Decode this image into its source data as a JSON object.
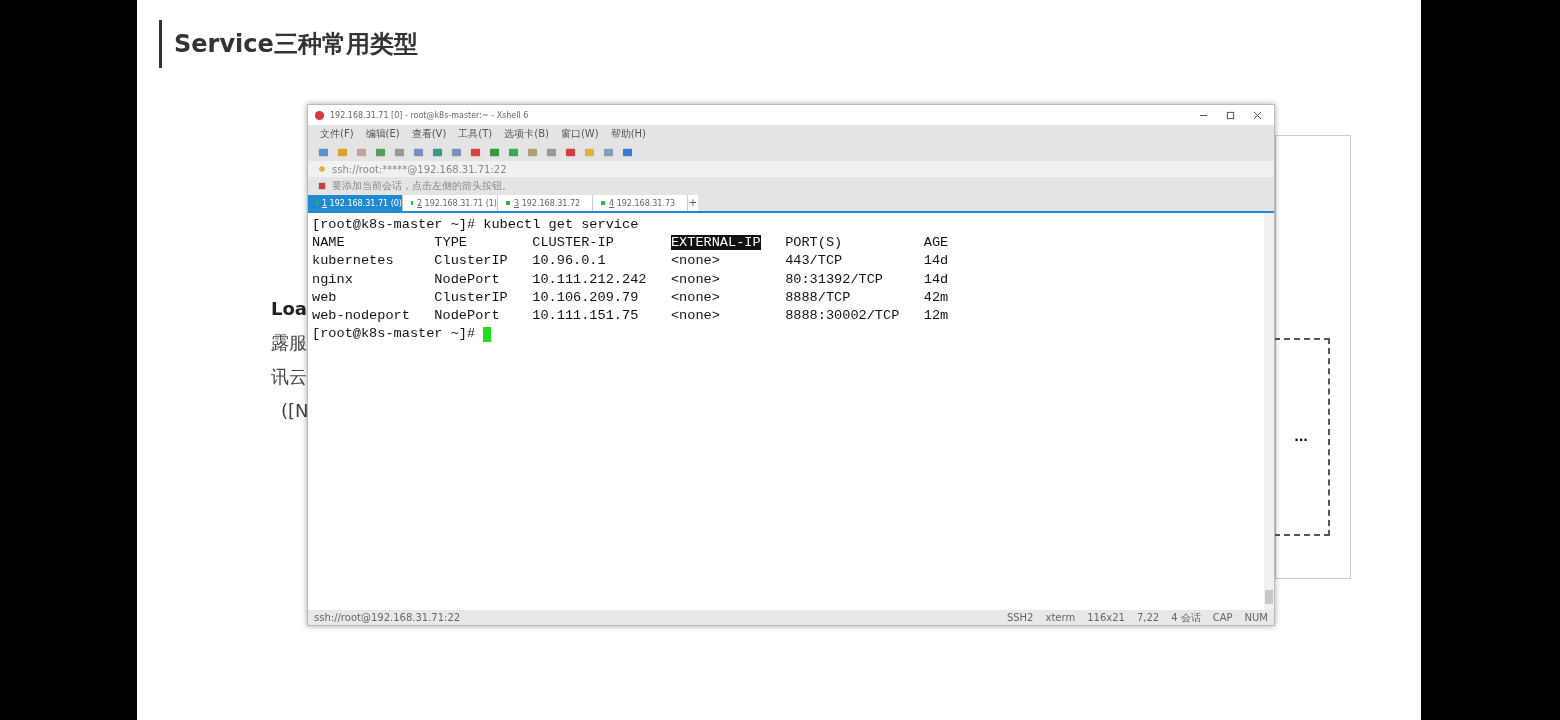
{
  "slide": {
    "title": "Service三种常用类型",
    "covered_text": [
      "Loa",
      "露服",
      "讯云",
      "([N"
    ],
    "diagram": {
      "label": "..."
    }
  },
  "window": {
    "title": "192.168.31.71 [0] - root@k8s-master:~ - Xshell 6",
    "menu": [
      "文件(F)",
      "编辑(E)",
      "查看(V)",
      "工具(T)",
      "选项卡(B)",
      "窗口(W)",
      "帮助(H)"
    ],
    "address": "ssh://root:*****@192.168.31.71:22",
    "session_hint": "要添加当前会话，点击左侧的箭头按钮。",
    "tabs": [
      {
        "number": "1",
        "label": "192.168.31.71 (0)",
        "selected": true
      },
      {
        "number": "2",
        "label": "192.168.31.71 (1)",
        "selected": false
      },
      {
        "number": "3",
        "label": "192.168.31.72",
        "selected": false
      },
      {
        "number": "4",
        "label": "192.168.31.73",
        "selected": false
      }
    ],
    "new_tab": "+",
    "terminal": {
      "command_line": "[root@k8s-master ~]# kubectl get service",
      "columns": [
        {
          "label": "NAME",
          "selected": false
        },
        {
          "label": "TYPE",
          "selected": false
        },
        {
          "label": "CLUSTER-IP",
          "selected": false
        },
        {
          "label": "EXTERNAL-IP",
          "selected": true
        },
        {
          "label": "PORT(S)",
          "selected": false
        },
        {
          "label": "AGE",
          "selected": false
        }
      ],
      "rows": [
        [
          "kubernetes",
          "ClusterIP",
          "10.96.0.1",
          "<none>",
          "443/TCP",
          "14d"
        ],
        [
          "nginx",
          "NodePort",
          "10.111.212.242",
          "<none>",
          "80:31392/TCP",
          "14d"
        ],
        [
          "web",
          "ClusterIP",
          "10.106.209.79",
          "<none>",
          "8888/TCP",
          "42m"
        ],
        [
          "web-nodeport",
          "NodePort",
          "10.111.151.75",
          "<none>",
          "8888:30002/TCP",
          "12m"
        ]
      ],
      "prompt": "[root@k8s-master ~]#"
    },
    "status_bar": {
      "connection": "ssh://root@192.168.31.71:22",
      "items": [
        "SSH2",
        "xterm",
        "116x21",
        "7,22",
        "4 会话",
        "CAP",
        "NUM"
      ]
    }
  }
}
